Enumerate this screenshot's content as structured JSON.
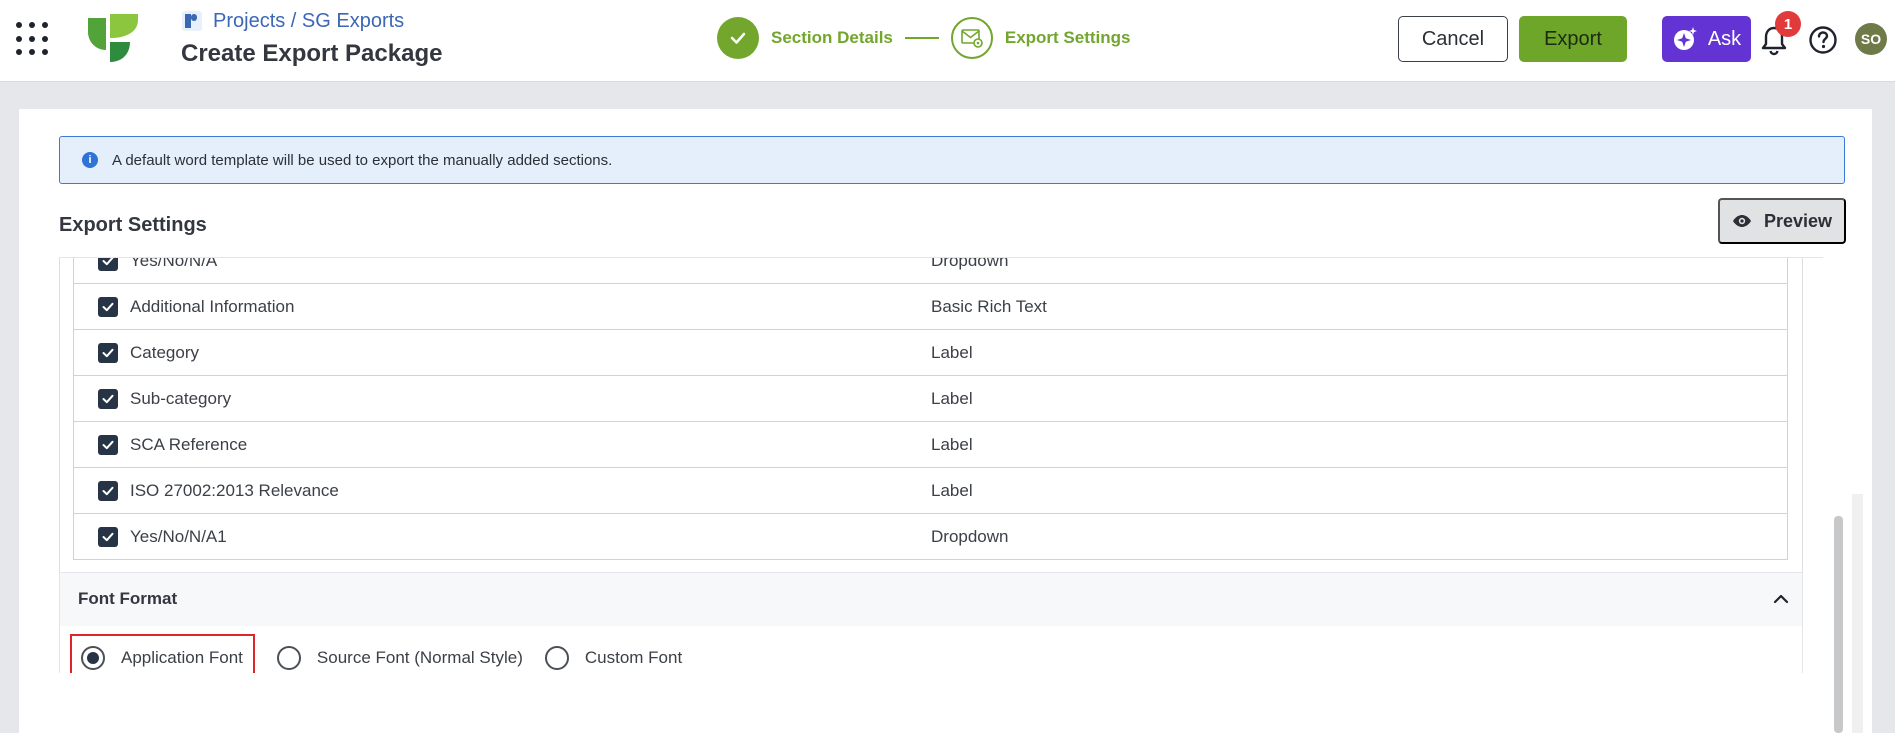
{
  "header": {
    "breadcrumb": "Projects / SG Exports",
    "title": "Create Export Package",
    "steps": [
      {
        "label": "Section Details",
        "state": "done"
      },
      {
        "label": "Export Settings",
        "state": "current"
      }
    ],
    "cancel_label": "Cancel",
    "export_label": "Export",
    "ask_label": "Ask",
    "notification_count": "1",
    "avatar_initials": "SO"
  },
  "main": {
    "info_message": "A default word template will be used to export the manually added sections.",
    "section_title": "Export Settings",
    "preview_label": "Preview",
    "fields": [
      {
        "name": "Yes/No/N/A",
        "type": "Dropdown",
        "checked": true
      },
      {
        "name": "Additional Information",
        "type": "Basic Rich Text",
        "checked": true
      },
      {
        "name": "Category",
        "type": "Label",
        "checked": true
      },
      {
        "name": "Sub-category",
        "type": "Label",
        "checked": true
      },
      {
        "name": "SCA Reference",
        "type": "Label",
        "checked": true
      },
      {
        "name": "ISO 27002:2013 Relevance",
        "type": "Label",
        "checked": true
      },
      {
        "name": "Yes/No/N/A1",
        "type": "Dropdown",
        "checked": true
      }
    ],
    "font_format": {
      "title": "Font Format",
      "options": [
        {
          "label": "Application Font",
          "selected": true
        },
        {
          "label": "Source Font (Normal Style)",
          "selected": false
        },
        {
          "label": "Custom Font",
          "selected": false
        }
      ]
    }
  },
  "colors": {
    "brand_green": "#72a62d",
    "ask_purple": "#6433d3",
    "info_blue": "#3c7bd6",
    "highlight_red": "#e0242b"
  }
}
